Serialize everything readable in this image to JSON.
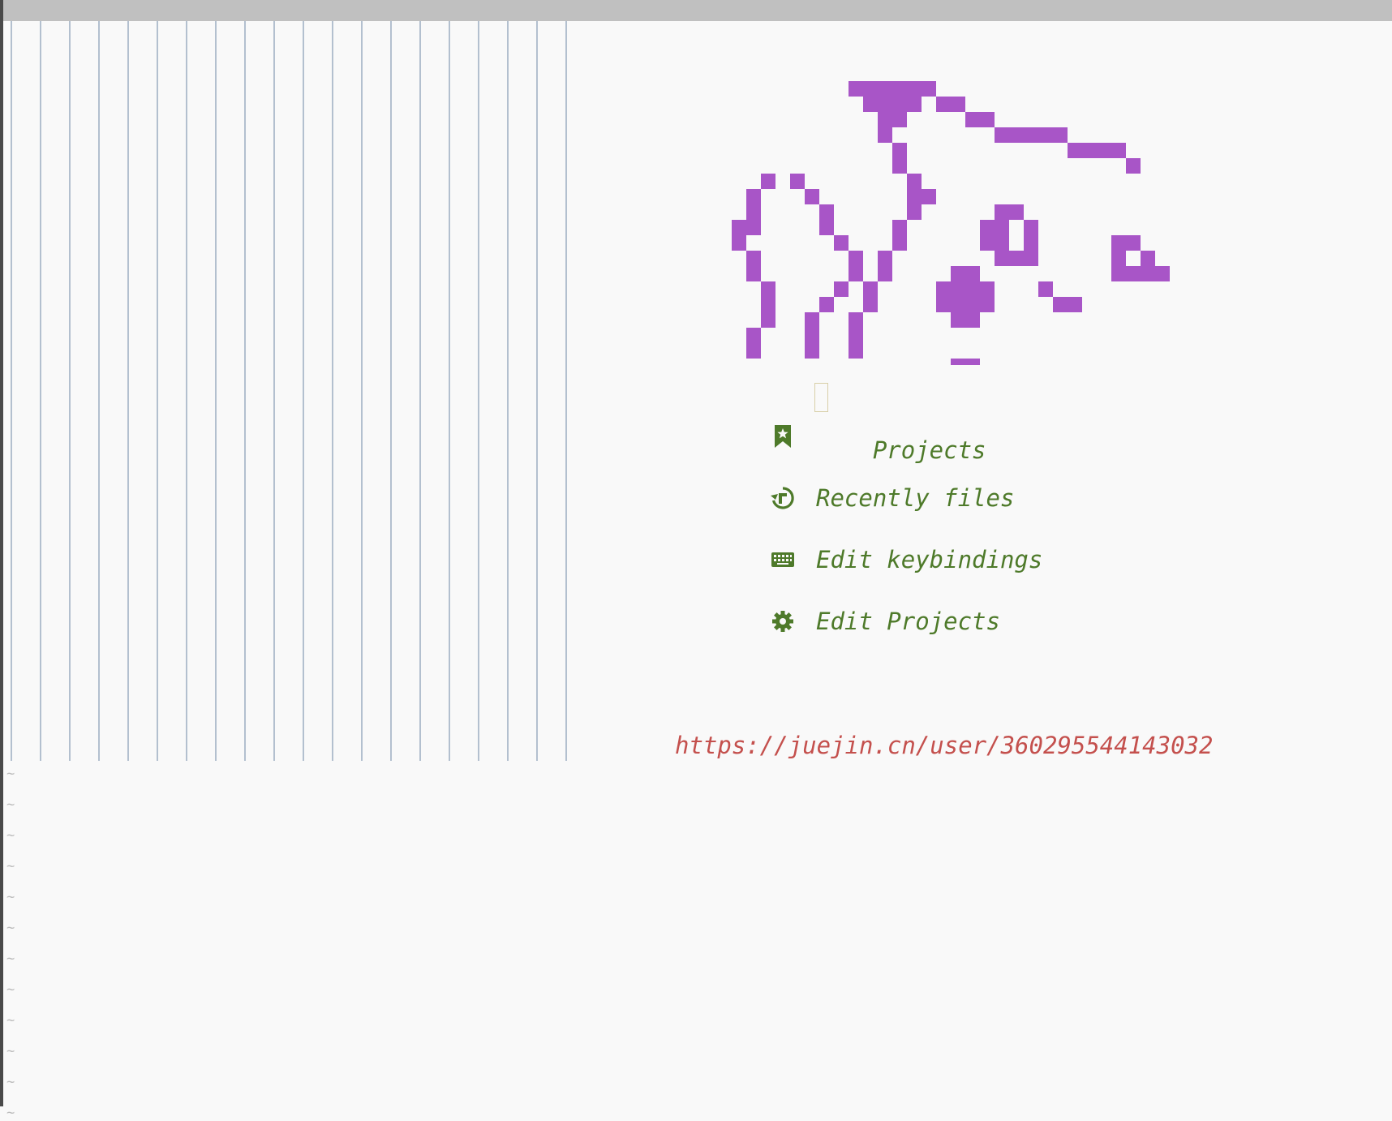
{
  "window": {
    "chrome_color": "#c0c0c0"
  },
  "editor": {
    "indent_guide_count": 20,
    "empty_line_marker": "~",
    "empty_line_count": 12
  },
  "logo": {
    "color": "#a855c7"
  },
  "menu": {
    "items": [
      {
        "icon": "bookmark-star-icon",
        "label": "Projects"
      },
      {
        "icon": "history-icon",
        "label": "Recently files"
      },
      {
        "icon": "keyboard-icon",
        "label": "Edit keybindings"
      },
      {
        "icon": "gear-icon",
        "label": "Edit Projects"
      }
    ],
    "text_color": "#4e7a2a",
    "cursor_item": "Projects"
  },
  "footer": {
    "url": "https://juejin.cn/user/360295544143032",
    "url_color": "#c4504d"
  }
}
